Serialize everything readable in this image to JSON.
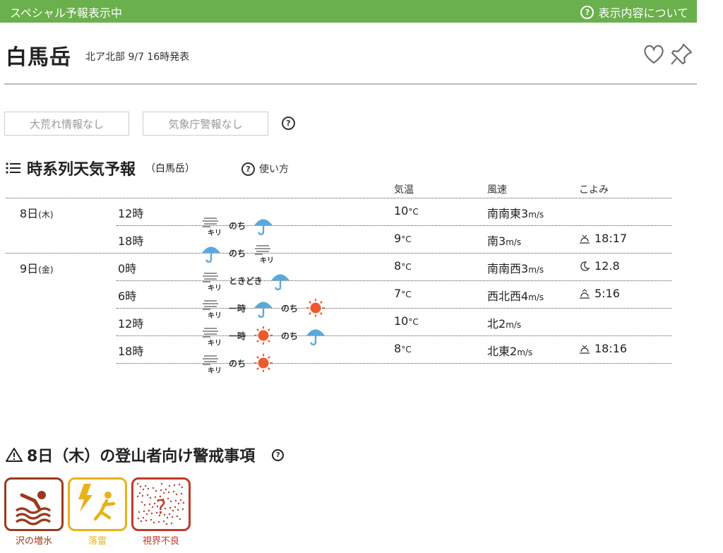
{
  "banner": {
    "left": "スペシャル予報表示中",
    "right": "表示内容について"
  },
  "header": {
    "title": "白馬岳",
    "subtitle": "北ア北部 9/7 16時発表"
  },
  "badges": [
    "大荒れ情報なし",
    "気象庁警報なし"
  ],
  "section": {
    "title": "時系列天気予報",
    "location": "（白馬岳）",
    "howto": "使い方"
  },
  "columns": {
    "temp": "気温",
    "wind": "風速",
    "koyomi": "こよみ"
  },
  "rows": [
    {
      "day": "8日",
      "dow": "(木)",
      "time": "12時",
      "temp": "10",
      "unit": "°C",
      "wind": "南南東3",
      "wind_unit": "m/s",
      "koyomi": ""
    },
    {
      "day": "",
      "dow": "",
      "time": "18時",
      "temp": "9",
      "unit": "°C",
      "wind": "南3",
      "wind_unit": "m/s",
      "koyomi": "18:17",
      "koyomi_icon": "sunset-icon"
    },
    {
      "day": "9日",
      "dow": "(金)",
      "time": "0時",
      "temp": "8",
      "unit": "°C",
      "wind": "南南西3",
      "wind_unit": "m/s",
      "koyomi": "12.8",
      "koyomi_icon": "moon-icon"
    },
    {
      "day": "",
      "dow": "",
      "time": "6時",
      "temp": "7",
      "unit": "°C",
      "wind": "西北西4",
      "wind_unit": "m/s",
      "koyomi": "5:16",
      "koyomi_icon": "sunrise-icon"
    },
    {
      "day": "",
      "dow": "",
      "time": "12時",
      "temp": "10",
      "unit": "°C",
      "wind": "北2",
      "wind_unit": "m/s",
      "koyomi": ""
    },
    {
      "day": "",
      "dow": "",
      "time": "18時",
      "temp": "8",
      "unit": "°C",
      "wind": "北東2",
      "wind_unit": "m/s",
      "koyomi": "18:16",
      "koyomi_icon": "sunset-icon"
    }
  ],
  "weather": [
    {
      "icons": [
        "fog-icon",
        "umbrella-icon"
      ],
      "words": [
        "のち"
      ]
    },
    {
      "icons": [
        "umbrella-icon",
        "fog-icon"
      ],
      "words": [
        "のち"
      ]
    },
    {
      "icons": [
        "fog-icon",
        "umbrella-icon"
      ],
      "words": [
        "ときどき"
      ]
    },
    {
      "icons": [
        "fog-icon",
        "umbrella-icon",
        "sun-icon"
      ],
      "words": [
        "一時",
        "のち"
      ]
    },
    {
      "icons": [
        "fog-icon",
        "sun-icon",
        "umbrella-icon"
      ],
      "words": [
        "一時",
        "のち"
      ]
    },
    {
      "icons": [
        "fog-icon",
        "sun-icon"
      ],
      "words": [
        "のち"
      ]
    }
  ],
  "fog_label": "キリ",
  "warning": {
    "title": "8日（木）の登山者向け警戒事項"
  },
  "cards": [
    {
      "label": "沢の増水",
      "color": "#9b3a1e",
      "icon": "swimmer-icon"
    },
    {
      "label": "落雷",
      "color": "#e7b21a",
      "icon": "lightning-icon"
    },
    {
      "label": "視界不良",
      "color": "#c0392b",
      "icon": "fog-dots-icon"
    }
  ]
}
